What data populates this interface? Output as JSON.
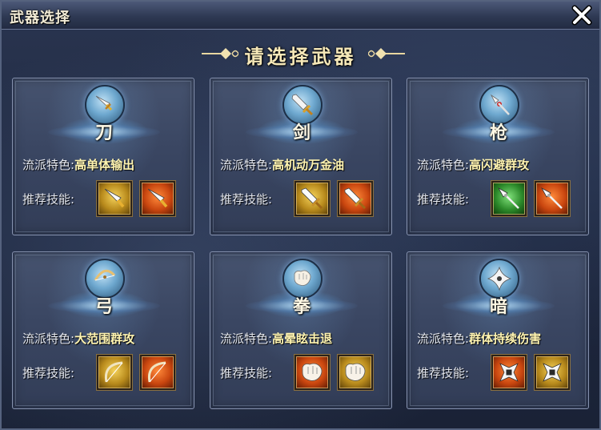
{
  "window": {
    "title": "武器选择"
  },
  "header": {
    "title": "请选择武器"
  },
  "trait_label": "流派特色:",
  "skill_label": "推荐技能:",
  "weapons": [
    {
      "name": "刀",
      "trait": "高单体输出",
      "icon": "saber-icon",
      "skills": [
        {
          "color": "gold",
          "icon": "saber-skill-icon"
        },
        {
          "color": "orange",
          "icon": "saber-skill-icon"
        }
      ]
    },
    {
      "name": "剑",
      "trait": "高机动万金油",
      "icon": "sword-icon",
      "skills": [
        {
          "color": "gold",
          "icon": "sword-skill-icon"
        },
        {
          "color": "orange",
          "icon": "sword-skill-icon"
        }
      ]
    },
    {
      "name": "枪",
      "trait": "高闪避群攻",
      "icon": "spear-icon",
      "skills": [
        {
          "color": "green",
          "icon": "spear-skill-icon"
        },
        {
          "color": "orange",
          "icon": "spear-skill-icon"
        }
      ]
    },
    {
      "name": "弓",
      "trait": "大范围群攻",
      "icon": "bow-icon",
      "skills": [
        {
          "color": "gold",
          "icon": "bow-skill-icon"
        },
        {
          "color": "orange",
          "icon": "bow-skill-icon"
        }
      ]
    },
    {
      "name": "拳",
      "trait": "高晕眩击退",
      "icon": "fist-icon",
      "skills": [
        {
          "color": "orange",
          "icon": "fist-skill-icon"
        },
        {
          "color": "gold",
          "icon": "fist-skill-icon"
        }
      ]
    },
    {
      "name": "暗",
      "trait": "群体持续伤害",
      "icon": "shuriken-icon",
      "skills": [
        {
          "color": "orange",
          "icon": "shuriken-skill-icon"
        },
        {
          "color": "gold",
          "icon": "shuriken-skill-icon"
        }
      ]
    }
  ]
}
